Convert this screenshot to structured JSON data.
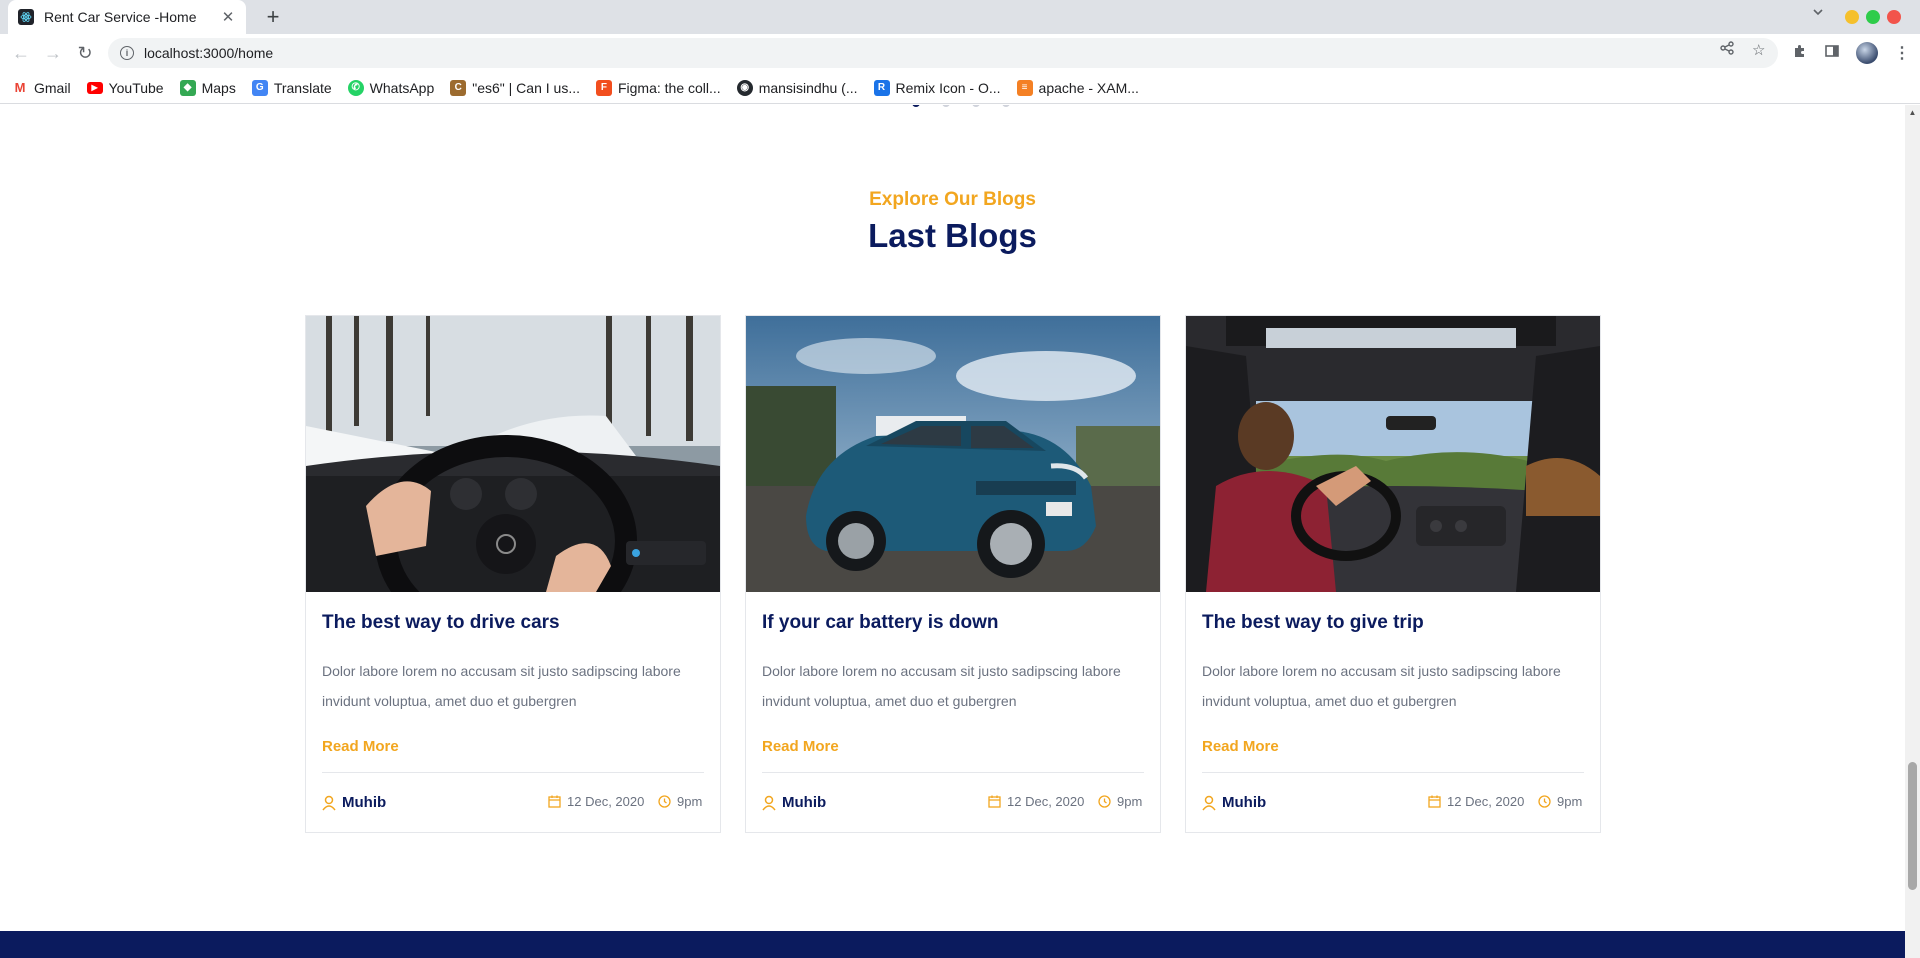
{
  "browser": {
    "tab_title": "Rent Car Service -Home",
    "tab_close": "✕",
    "new_tab": "+",
    "url": "localhost:3000/home",
    "bookmarks": [
      {
        "label": "Gmail",
        "icon": "gmail-icon",
        "color": "#ea4335",
        "glyph": "M"
      },
      {
        "label": "YouTube",
        "icon": "youtube-icon",
        "color": "#ff0000",
        "glyph": "▶"
      },
      {
        "label": "Maps",
        "icon": "maps-icon",
        "color": "#34a853",
        "glyph": "◆"
      },
      {
        "label": "Translate",
        "icon": "translate-icon",
        "color": "#4285f4",
        "glyph": "G"
      },
      {
        "label": "WhatsApp",
        "icon": "whatsapp-icon",
        "color": "#25d366",
        "glyph": "✆"
      },
      {
        "label": "\"es6\" | Can I us...",
        "icon": "caniuse-icon",
        "color": "#9c6b2f",
        "glyph": "C"
      },
      {
        "label": "Figma: the coll...",
        "icon": "figma-icon",
        "color": "#f24e1e",
        "glyph": "F"
      },
      {
        "label": "mansisindhu (...",
        "icon": "github-icon",
        "color": "#24292e",
        "glyph": "◉"
      },
      {
        "label": "Remix Icon - O...",
        "icon": "remix-icon",
        "color": "#1a73e8",
        "glyph": "R"
      },
      {
        "label": "apache - XAM...",
        "icon": "stackoverflow-icon",
        "color": "#f48024",
        "glyph": "≡"
      }
    ]
  },
  "section": {
    "subtitle": "Explore Our Blogs",
    "title": "Last Blogs"
  },
  "blogs": [
    {
      "title": "The best way to drive cars",
      "text": "Dolor labore lorem no accusam sit justo sadipscing labore invidunt voluptua, amet duo et gubergren",
      "read_more": "Read More",
      "author": "Muhib",
      "date": "12 Dec, 2020",
      "time": "9pm"
    },
    {
      "title": "If your car battery is down",
      "text": "Dolor labore lorem no accusam sit justo sadipscing labore invidunt voluptua, amet duo et gubergren",
      "read_more": "Read More",
      "author": "Muhib",
      "date": "12 Dec, 2020",
      "time": "9pm"
    },
    {
      "title": "The best way to give trip",
      "text": "Dolor labore lorem no accusam sit justo sadipscing labore invidunt voluptua, amet duo et gubergren",
      "read_more": "Read More",
      "author": "Muhib",
      "date": "12 Dec, 2020",
      "time": "9pm"
    }
  ],
  "colors": {
    "accent": "#f2a61f",
    "primary": "#0b1b5e"
  }
}
